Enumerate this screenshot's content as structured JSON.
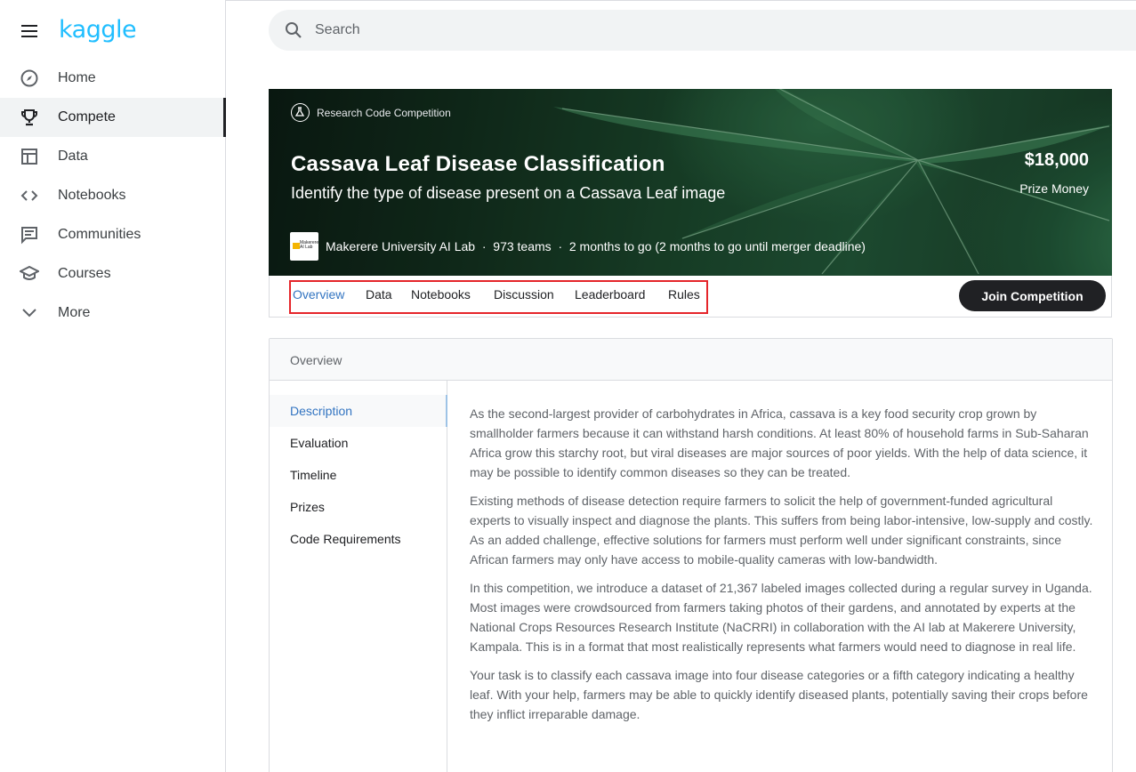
{
  "sidebar": {
    "logo": "kaggle",
    "items": [
      {
        "label": "Home",
        "icon": "compass-icon"
      },
      {
        "label": "Compete",
        "icon": "trophy-icon",
        "active": true
      },
      {
        "label": "Data",
        "icon": "table-icon"
      },
      {
        "label": "Notebooks",
        "icon": "code-icon"
      },
      {
        "label": "Communities",
        "icon": "chat-icon"
      },
      {
        "label": "Courses",
        "icon": "graduation-cap-icon"
      },
      {
        "label": "More",
        "icon": "chevron-down-icon"
      }
    ]
  },
  "search": {
    "placeholder": "Search"
  },
  "competition": {
    "badge": "Research Code Competition",
    "title": "Cassava Leaf Disease Classification",
    "subtitle": "Identify the type of disease present on a Cassava Leaf image",
    "prize_amount": "$18,000",
    "prize_label": "Prize Money",
    "host_line": "Makerere University AI Lab  ·  973 teams  ·  2 months to go (2 months to go until merger deadline)",
    "host_logo_text": "Makerere AI Lab"
  },
  "tabs": [
    {
      "label": "Overview",
      "active": true
    },
    {
      "label": "Data"
    },
    {
      "label": "Notebooks"
    },
    {
      "label": "Discussion"
    },
    {
      "label": "Leaderboard"
    },
    {
      "label": "Rules"
    }
  ],
  "join_button": "Join Competition",
  "overview": {
    "header": "Overview",
    "subnav": [
      {
        "label": "Description",
        "active": true
      },
      {
        "label": "Evaluation"
      },
      {
        "label": "Timeline"
      },
      {
        "label": "Prizes"
      },
      {
        "label": "Code Requirements"
      }
    ],
    "paragraphs": [
      "As the second-largest provider of carbohydrates in Africa, cassava is a key food security crop grown by smallholder farmers because it can withstand harsh conditions. At least 80% of household farms in Sub-Saharan Africa grow this starchy root, but viral diseases are major sources of poor yields. With the help of data science, it may be possible to identify common diseases so they can be treated.",
      "Existing methods of disease detection require farmers to solicit the help of government-funded agricultural experts to visually inspect and diagnose the plants. This suffers from being labor-intensive, low-supply and costly. As an added challenge, effective solutions for farmers must perform well under significant constraints, since African farmers may only have access to mobile-quality cameras with low-bandwidth.",
      "In this competition, we introduce a dataset of 21,367 labeled images collected during a regular survey in Uganda. Most images were crowdsourced from farmers taking photos of their gardens, and annotated by experts at the National Crops Resources Research Institute (NaCRRI) in collaboration with the AI lab at Makerere University, Kampala. This is in a format that most realistically represents what farmers would need to diagnose in real life.",
      "Your task is to classify each cassava image into four disease categories or a fifth category indicating a healthy leaf. With your help, farmers may be able to quickly identify diseased plants, potentially saving their crops before they inflict irreparable damage."
    ]
  },
  "colors": {
    "brand": "#20beff",
    "highlight_box": "#e5252a",
    "active_link": "#3274c1"
  }
}
